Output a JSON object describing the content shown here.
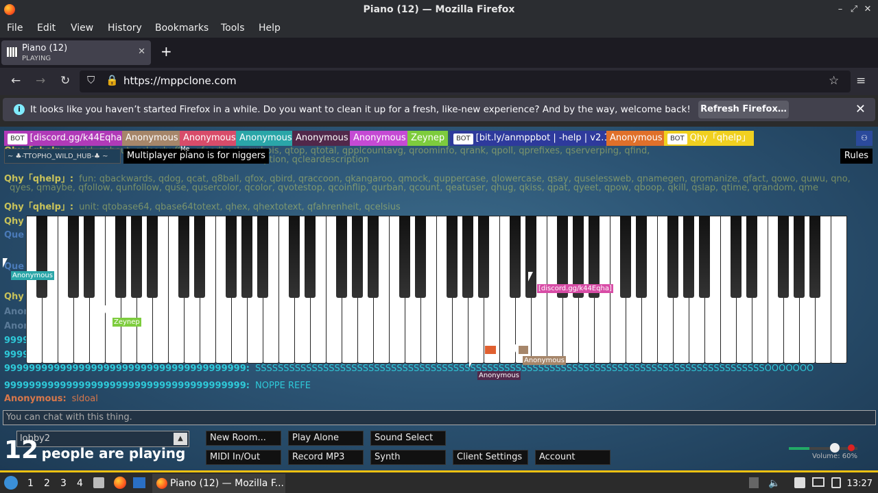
{
  "window": {
    "title": "Piano (12) — Mozilla Firefox"
  },
  "menu": [
    "File",
    "Edit",
    "View",
    "History",
    "Bookmarks",
    "Tools",
    "Help"
  ],
  "tab": {
    "title": "Piano (12)",
    "subtitle": "PLAYING",
    "close": "✕",
    "new": "+"
  },
  "nav": {
    "url": "https://mppclone.com"
  },
  "notification": {
    "message": "It looks like you haven’t started Firefox in a while. Do you want to clean it up for a fresh, like-new experience? And by the way, welcome back!",
    "button": "Refresh Firefox…",
    "close": "✕"
  },
  "users": [
    {
      "name": "[discord.gg/k44Eqha]",
      "bot": true,
      "color": "#b03ab8"
    },
    {
      "name": "Anonymous",
      "bot": false,
      "color": "#a6866a"
    },
    {
      "name": "Anonymous",
      "bot": false,
      "color": "#d84c6a"
    },
    {
      "name": "Anonymous",
      "bot": false,
      "color": "#2aa6a8"
    },
    {
      "name": "Anonymous",
      "bot": false,
      "color": "#51284a"
    },
    {
      "name": "Anonymous",
      "bot": false,
      "color": "#c54ad4"
    },
    {
      "name": "Zeynep",
      "bot": false,
      "color": "#7dcc3d"
    },
    {
      "name": "[bit.ly/anmppbot | -help | v2.1]",
      "bot": true,
      "color": "#2e3a9c"
    },
    {
      "name": "Anonymous",
      "bot": false,
      "color": "#e0702a"
    },
    {
      "name": "Qhy「qhelp」",
      "bot": true,
      "color": "#f0d020"
    }
  ],
  "bot_label": "BOT",
  "room": {
    "list_label": "~ ♣-TTOPHO_WILD_HUB-♣ ~",
    "name": "Multiplayer piano is for niggers",
    "me": "Me",
    "rules": "Rules"
  },
  "chat": [
    {
      "name": "Qhy「qhelp」:",
      "text": "qid, qabout, qclearbuffer, qfeedback, qwhois, qtop, qtotal, qpplcountavg, qroominfo, qrank, qpoll, qprefixes, qserverping, qfind,"
    },
    {
      "name": "",
      "text": "tdescription, qcleardescription"
    },
    {
      "name": "Qhy「qhelp」:",
      "text": "fun: qbackwards, qdog, qcat, q8ball, qfox, qbird, qraccoon, qkangaroo, qmock, quppercase, qlowercase, qsay, quselessweb, qnamegen, qromanize, qfact, qowo, quwu, qno,"
    },
    {
      "name": "",
      "text": "qyes, qmaybe, qfollow, qunfollow, quse, qusercolor, qcolor, qvotestop, qcoinflip, qurban, qcount, qeatuser, qhug, qkiss, qpat, qyeet, qpow, qboop, qkill, qslap, qtime, qrandom, qme"
    },
    {
      "name": "Qhy「qhelp」:",
      "text": "unit: qtobase64, qbase64totext, qhex, qhextotext, qfahrenheit, qcelsius"
    },
    {
      "name": "999999999999999999999999999999999999999:",
      "text": "SSSSSSSSSSSSSSSSSSSSSSSSSSSSSSSSSSSSSSSSSSSSSSSSSSSSSSSSSSSSSSSSSSSSSSSSSSSSSSSSSSSSSSSSSSOOOOOOO"
    },
    {
      "name": "999999999999999999999999999999999999999:",
      "text": "NOPPE REFE"
    },
    {
      "name": "Anonymous:",
      "text": "sldoal"
    }
  ],
  "left_names": [
    "Qhy",
    "Que",
    "",
    "Que",
    "Qhy",
    "Anon",
    "Anon",
    "9999",
    "9999"
  ],
  "cursors": [
    {
      "label": "Anonymous",
      "color": "#2aa6a8"
    },
    {
      "label": "Zeynep",
      "color": "#7dcc3d"
    },
    {
      "label": "[discord.gg/k44Eqha]",
      "color": "#d84ca6"
    },
    {
      "label": "Anonymous",
      "color": "#a6866a"
    },
    {
      "label": "Anonymous",
      "color": "#51284a"
    }
  ],
  "chat_placeholder": "You can chat with this thing.",
  "room_select": "lobby2",
  "people": {
    "count": "12",
    "text": "people are playing"
  },
  "buttons": [
    "New Room...",
    "Play Alone",
    "Sound Select",
    "MIDI In/Out",
    "Record MP3",
    "Synth",
    "Client Settings",
    "Account"
  ],
  "volume": {
    "label": "Volume: 60%",
    "value": 0.6
  },
  "taskbar": {
    "workspaces": [
      "1",
      "2",
      "3",
      "4"
    ],
    "window": "Piano (12) — Mozilla F...",
    "clock": "13:27"
  }
}
